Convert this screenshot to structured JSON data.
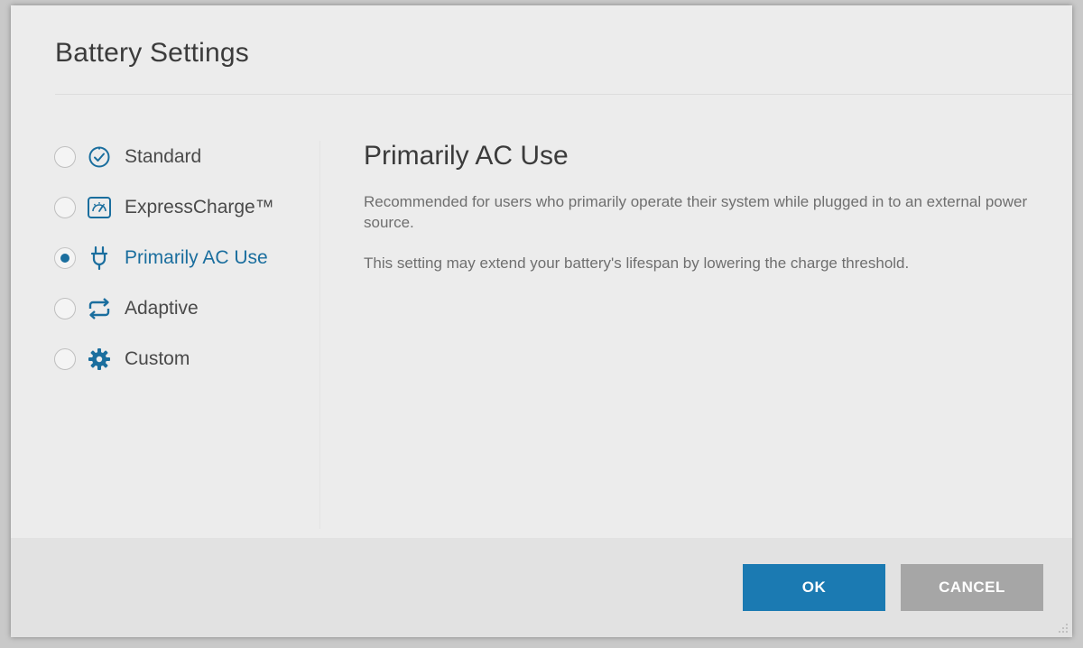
{
  "dialog": {
    "title": "Battery Settings"
  },
  "options": [
    {
      "id": "standard",
      "label": "Standard",
      "icon": "clock-check-icon",
      "selected": false
    },
    {
      "id": "expresscharge",
      "label": "ExpressCharge™",
      "icon": "gauge-icon",
      "selected": false
    },
    {
      "id": "primarily-ac",
      "label": "Primarily AC Use",
      "icon": "plug-icon",
      "selected": true
    },
    {
      "id": "adaptive",
      "label": "Adaptive",
      "icon": "cycle-arrows-icon",
      "selected": false
    },
    {
      "id": "custom",
      "label": "Custom",
      "icon": "gear-icon",
      "selected": false
    }
  ],
  "detail": {
    "title": "Primarily AC Use",
    "description": "Recommended for users who primarily operate their system while plugged in to an external power source.",
    "note": "This setting may extend your battery's lifespan by lowering the charge threshold."
  },
  "footer": {
    "ok_label": "OK",
    "cancel_label": "CANCEL"
  },
  "colors": {
    "accent": "#1a6e9e",
    "ok_button": "#1b7ab2",
    "cancel_button": "#a6a6a6",
    "icon_blue": "#1a6e9e"
  }
}
